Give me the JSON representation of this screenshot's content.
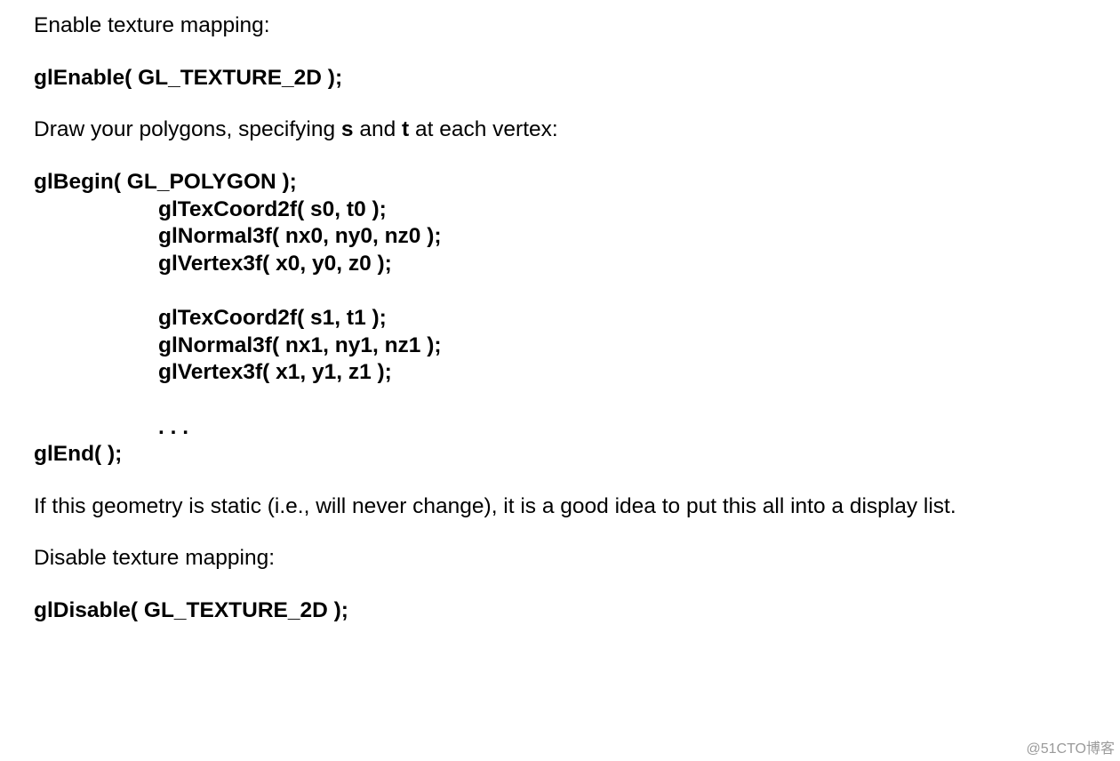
{
  "p1": "Enable texture mapping:",
  "c1": "glEnable( GL_TEXTURE_2D );",
  "p2_pre": "Draw your polygons, specifying ",
  "p2_s": "s",
  "p2_mid": " and ",
  "p2_t": "t",
  "p2_post": " at each vertex:",
  "code": {
    "begin": "glBegin( GL_POLYGON );",
    "l1": "glTexCoord2f( s0, t0 );",
    "l2": "glNormal3f( nx0, ny0, nz0 );",
    "l3": "glVertex3f( x0, y0, z0 );",
    "l4": "glTexCoord2f( s1, t1 );",
    "l5": "glNormal3f( nx1, ny1, nz1 );",
    "l6": "glVertex3f( x1, y1, z1 );",
    "dots": ". . .",
    "end": "glEnd( );"
  },
  "p3": "If this geometry is static (i.e., will never change), it is a good idea to put this all into a display list.",
  "p4": "Disable texture mapping:",
  "c2": "glDisable( GL_TEXTURE_2D );",
  "watermark": "@51CTO博客"
}
